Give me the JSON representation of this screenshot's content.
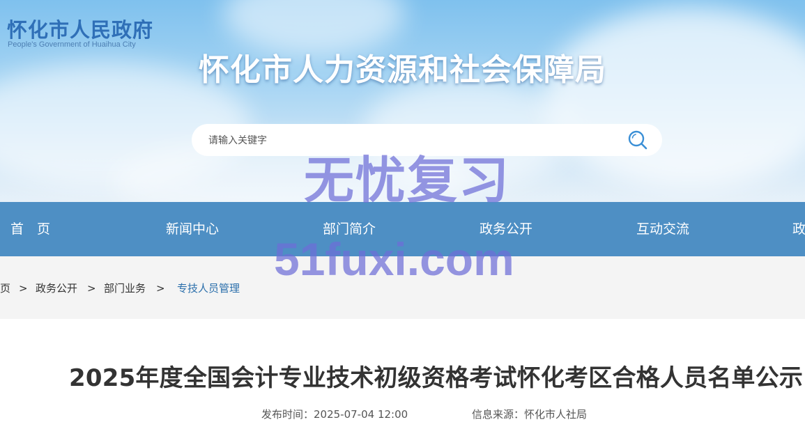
{
  "header": {
    "logo_cn": "怀化市人民政府",
    "logo_en": "People's Government of Huaihua City",
    "site_title": "怀化市人力资源和社会保障局"
  },
  "search": {
    "placeholder": "请输入关键字",
    "icon": "search-icon"
  },
  "nav": {
    "items": [
      {
        "label": "首　页"
      },
      {
        "label": "新闻中心"
      },
      {
        "label": "部门简介"
      },
      {
        "label": "政务公开"
      },
      {
        "label": "互动交流"
      },
      {
        "label": "政"
      }
    ]
  },
  "breadcrumb": {
    "items": [
      "页",
      "政务公开",
      "部门业务",
      "专技人员管理"
    ],
    "separator": ">"
  },
  "article": {
    "title": "2025年度全国会计专业技术初级资格考试怀化考区合格人员名单公示",
    "publish_label": "发布时间：2025-07-04 12:00",
    "source_label": "信息来源：怀化市人社局"
  },
  "watermark": {
    "line1": "无忧复习",
    "line2": "51fuxi.com"
  },
  "colors": {
    "nav_bg": "#4e8fc4",
    "breadcrumb_active": "#2b6fab",
    "title_text": "#333333"
  }
}
